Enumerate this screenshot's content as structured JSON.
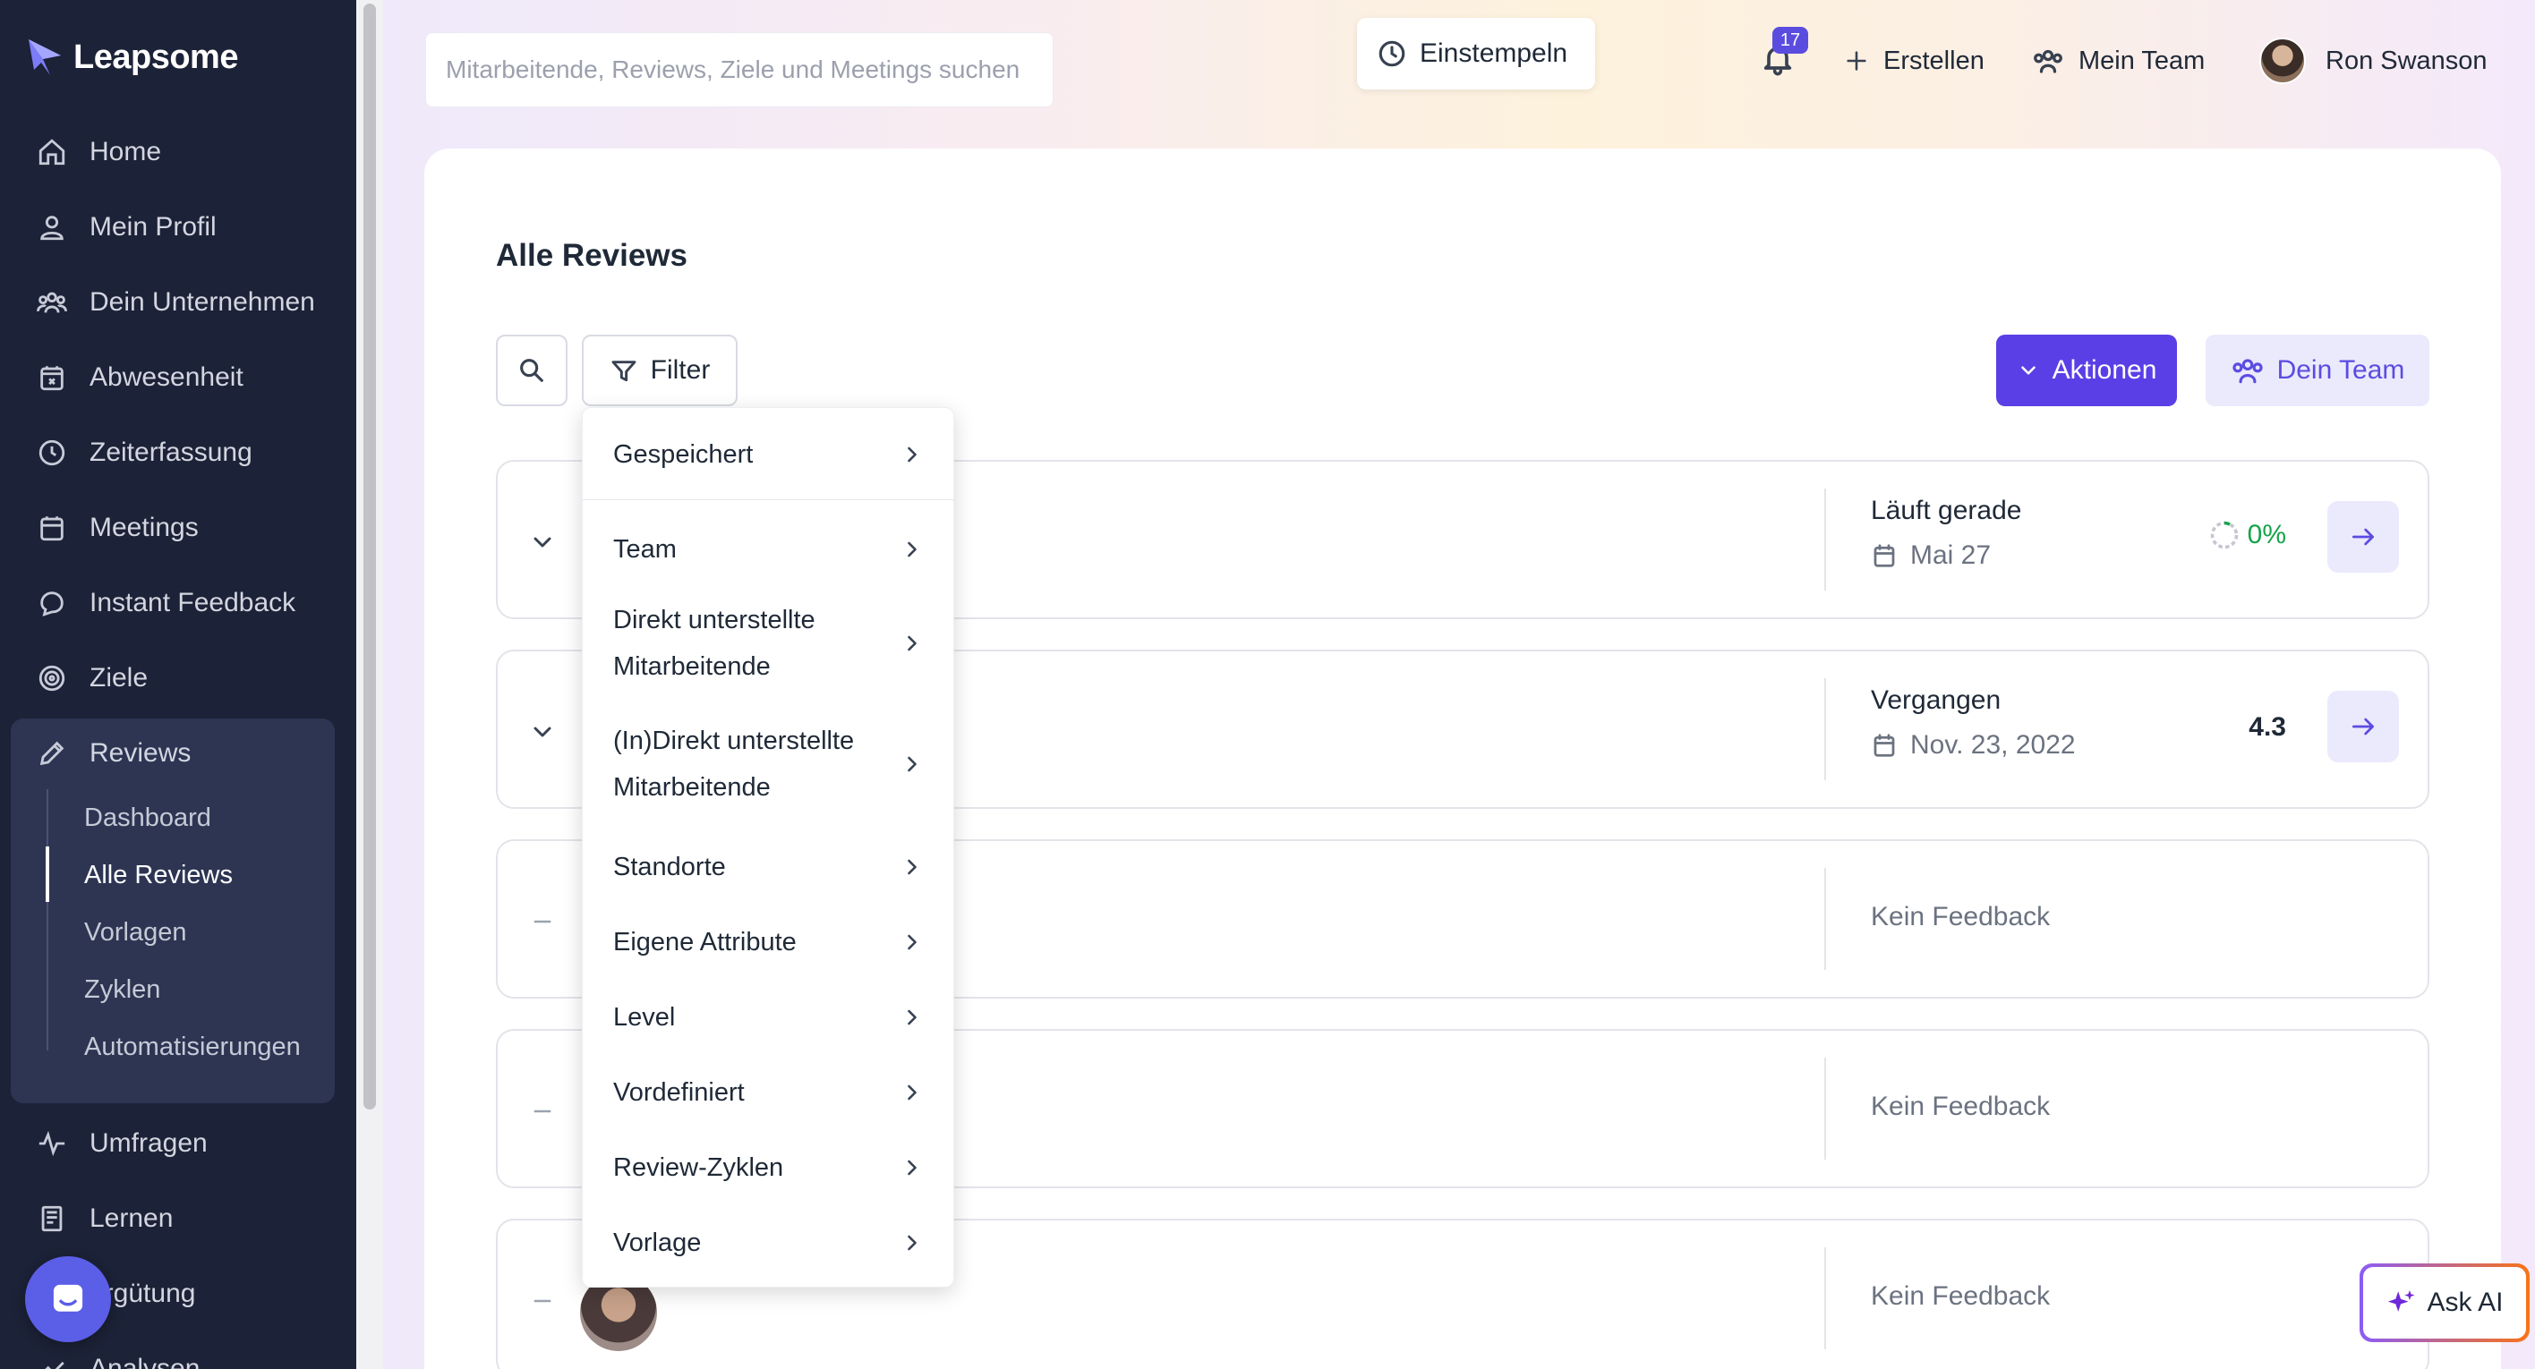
{
  "app": {
    "brand": "Leapsome"
  },
  "sidebar": {
    "items": [
      {
        "label": "Home",
        "icon": "home-icon"
      },
      {
        "label": "Mein Profil",
        "icon": "user-icon"
      },
      {
        "label": "Dein Unternehmen",
        "icon": "users-icon"
      },
      {
        "label": "Abwesenheit",
        "icon": "calendar-x-icon"
      },
      {
        "label": "Zeiterfassung",
        "icon": "clock-icon"
      },
      {
        "label": "Meetings",
        "icon": "calendar-icon"
      },
      {
        "label": "Instant Feedback",
        "icon": "chat-icon"
      },
      {
        "label": "Ziele",
        "icon": "target-icon"
      },
      {
        "label": "Reviews",
        "icon": "pencil-icon"
      },
      {
        "label": "Umfragen",
        "icon": "pulse-icon"
      },
      {
        "label": "Lernen",
        "icon": "book-icon"
      },
      {
        "label": "ergütung",
        "icon": "money-icon"
      },
      {
        "label": "Analysen",
        "icon": "chart-icon"
      }
    ],
    "reviews_sub": [
      "Dashboard",
      "Alle Reviews",
      "Vorlagen",
      "Zyklen",
      "Automatisierungen"
    ],
    "active_sub": "Alle Reviews"
  },
  "topbar": {
    "search_placeholder": "Mitarbeitende, Reviews, Ziele und Meetings suchen",
    "clock_in": "Einstempeln",
    "notifications_count": "17",
    "create": "Erstellen",
    "my_team": "Mein Team",
    "user_name": "Ron Swanson"
  },
  "main": {
    "title": "Alle Reviews",
    "filter_label": "Filter",
    "actions_label": "Aktionen",
    "your_team_label": "Dein Team",
    "cards": [
      {
        "status": "Läuft gerade",
        "date": "Mai 27",
        "progress": "0%"
      },
      {
        "status": "Vergangen",
        "date": "Nov. 23, 2022",
        "score": "4.3"
      },
      {
        "status": "Kein Feedback"
      },
      {
        "status": "Kein Feedback"
      },
      {
        "status": "Kein Feedback"
      }
    ]
  },
  "filter_menu": {
    "items": [
      "Gespeichert",
      "Team",
      "Direkt unterstellte Mitarbeitende",
      "(In)Direkt unterstellte Mitarbeitende",
      "Standorte",
      "Eigene Attribute",
      "Level",
      "Vordefiniert",
      "Review-Zyklen",
      "Vorlage"
    ]
  },
  "ask_ai": "Ask AI",
  "colors": {
    "sidebar_bg": "#1c2237",
    "accent": "#5b3fe6",
    "accent_light": "#ebe9fc",
    "progress_green": "#16a34a"
  }
}
